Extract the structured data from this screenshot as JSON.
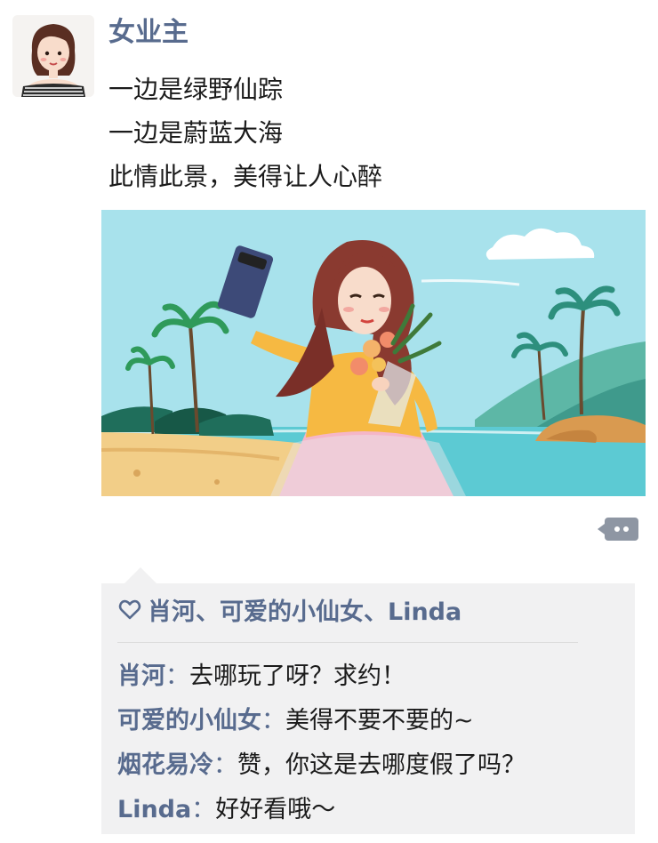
{
  "post": {
    "username": "女业主",
    "lines": [
      "一边是绿野仙踪",
      "一边是蔚蓝大海",
      "此情此景，美得让人心醉"
    ]
  },
  "interactions": {
    "likes_text": "肖河、可爱的小仙女、Linda",
    "comment_separator": "：",
    "comments": [
      {
        "author": "肖河",
        "text": "去哪玩了呀？求约！"
      },
      {
        "author": "可爱的小仙女",
        "text": "美得不要不要的~"
      },
      {
        "author": "烟花易冷",
        "text": "赞，你这是去哪度假了吗？"
      },
      {
        "author": "Linda",
        "text": "好好看哦～"
      }
    ]
  },
  "colors": {
    "name_blue": "#586b8e",
    "panel_bg": "#f1f1f2",
    "comment_button": "#8e96a3"
  },
  "icons": {
    "like": "heart-outline-icon",
    "comment": "comment-dots-icon"
  }
}
